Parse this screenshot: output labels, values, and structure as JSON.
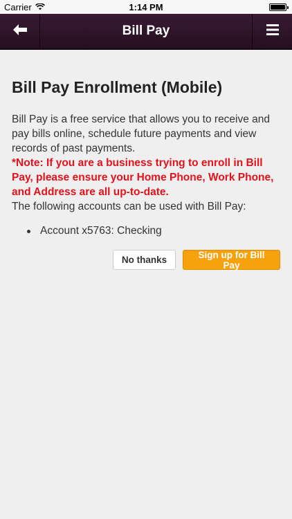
{
  "status_bar": {
    "carrier": "Carrier",
    "time": "1:14 PM"
  },
  "nav": {
    "title": "Bill Pay",
    "back_icon": "arrow-left-icon",
    "menu_icon": "hamburger-menu-icon",
    "background_color": "#2e1429"
  },
  "page": {
    "title": "Bill Pay Enrollment (Mobile)",
    "intro": "Bill Pay is a free service that allows you to receive and pay bills online, schedule future payments and view records of past payments.",
    "note": "*Note: If you are a business trying to enroll in Bill Pay, please ensure your Home Phone, Work Phone, and Address are all up-to-date.",
    "accounts_label": "The following accounts can be used with Bill Pay:",
    "accounts": [
      {
        "label": "Account x5763: Checking"
      }
    ]
  },
  "actions": {
    "decline_label": "No thanks",
    "signup_label": "Sign up for Bill Pay",
    "accent_color": "#f7a10d",
    "note_color": "#e3121b"
  }
}
